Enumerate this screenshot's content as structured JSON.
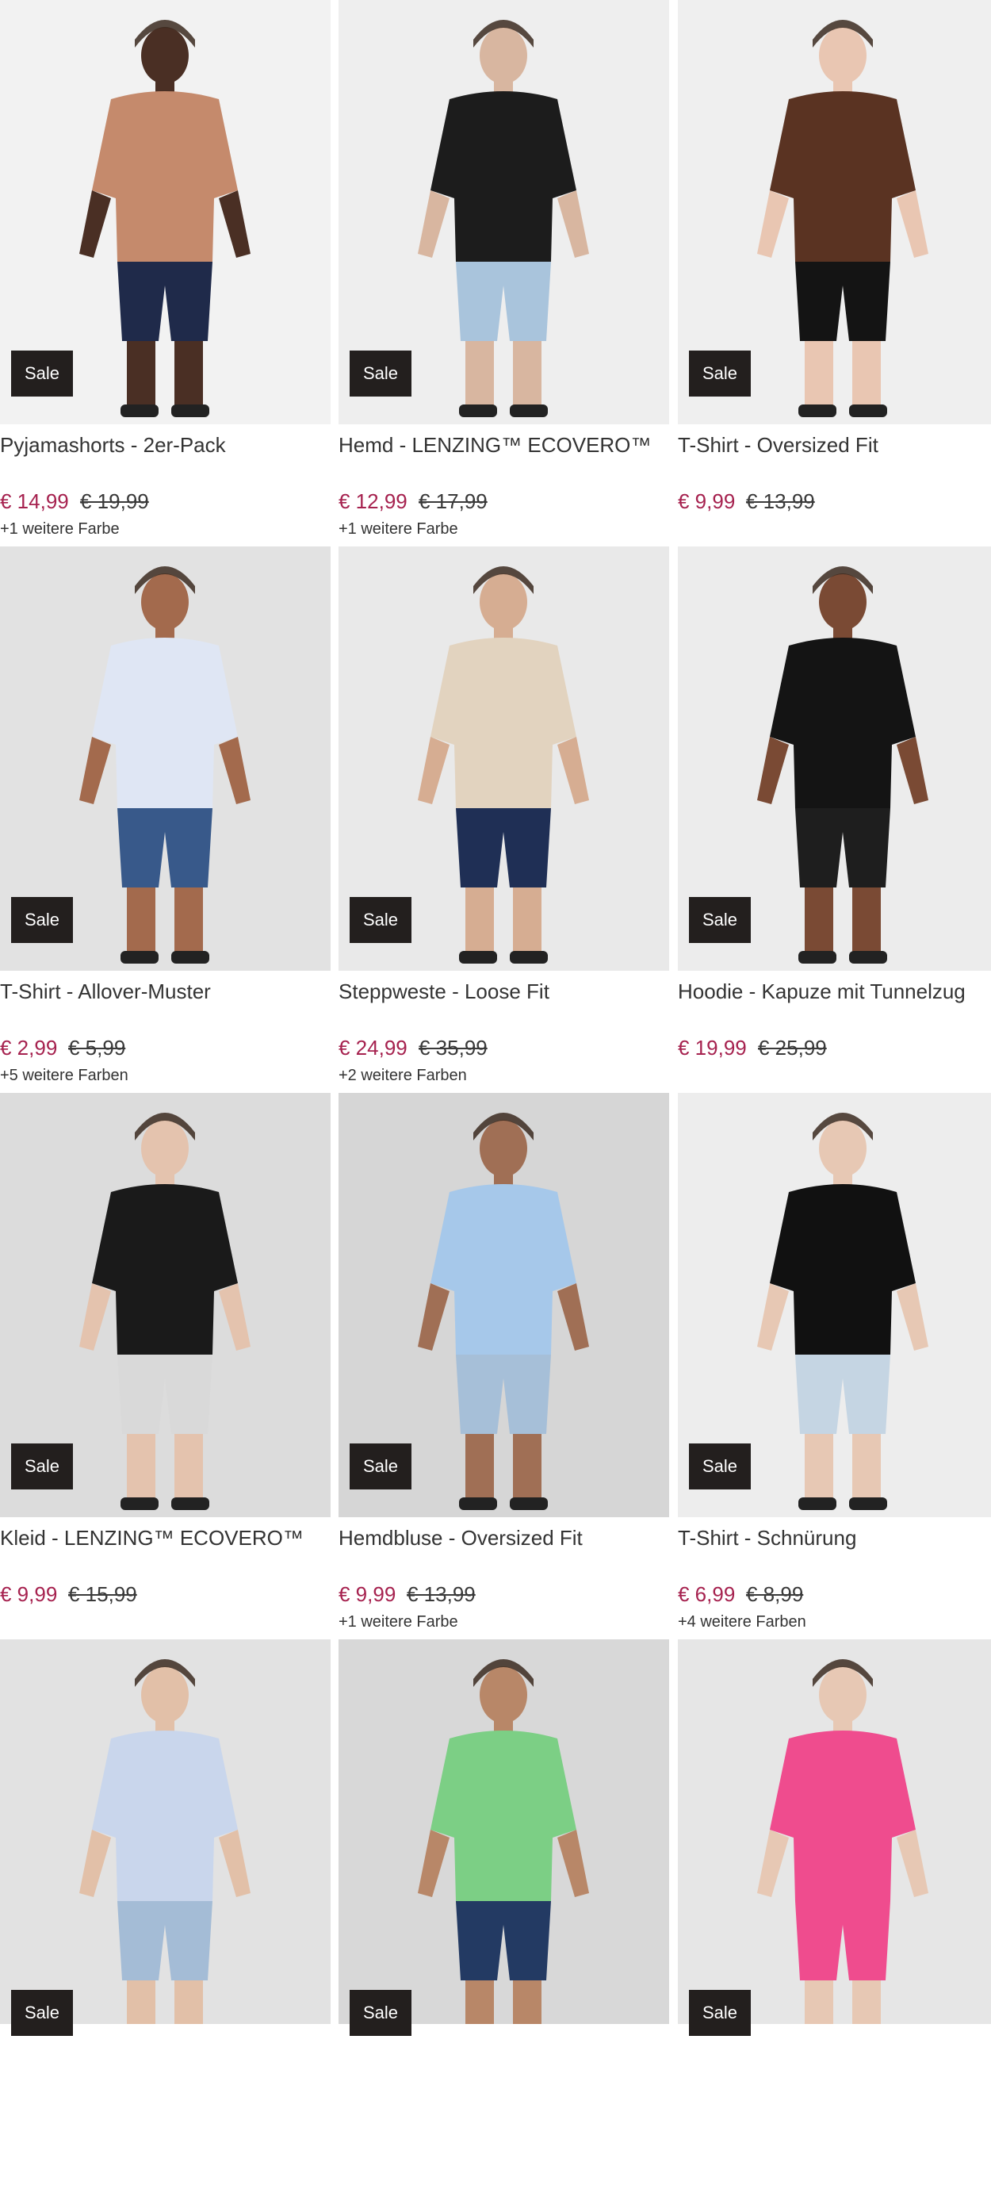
{
  "products": [
    {
      "title": "Pyjamashorts - 2er-Pack",
      "price": "€ 14,99",
      "old_price": "€ 19,99",
      "colors": "+1 weitere Farbe",
      "badge": "Sale",
      "bg": "#f2f2f2",
      "top": "#c58a6c",
      "bottom": "#1f2a4a",
      "skin": "#4a2f24"
    },
    {
      "title": "Hemd - LENZING™ ECOVERO™",
      "price": "€ 12,99",
      "old_price": "€ 17,99",
      "colors": "+1 weitere Farbe",
      "badge": "Sale",
      "bg": "#eeeeee",
      "top": "#1c1c1c",
      "bottom": "#a9c4dc",
      "skin": "#d8b6a0"
    },
    {
      "title": "T-Shirt - Oversized Fit",
      "price": "€ 9,99",
      "old_price": "€ 13,99",
      "colors": "",
      "badge": "Sale",
      "bg": "#efefef",
      "top": "#5a3322",
      "bottom": "#141414",
      "skin": "#e9c6b2"
    },
    {
      "title": "T-Shirt - Allover-Muster",
      "price": "€ 2,99",
      "old_price": "€ 5,99",
      "colors": "+5 weitere Farben",
      "badge": "Sale",
      "bg": "#e2e2e2",
      "top": "#dfe6f4",
      "bottom": "#38598a",
      "skin": "#a36a4d"
    },
    {
      "title": "Steppweste - Loose Fit",
      "price": "€ 24,99",
      "old_price": "€ 35,99",
      "colors": "+2 weitere Farben",
      "badge": "Sale",
      "bg": "#e9e9e9",
      "top": "#e2d3bf",
      "bottom": "#1f2f55",
      "skin": "#d6ad92"
    },
    {
      "title": "Hoodie - Kapuze mit Tunnelzug",
      "price": "€ 19,99",
      "old_price": "€ 25,99",
      "colors": "",
      "badge": "Sale",
      "bg": "#ececec",
      "top": "#141414",
      "bottom": "#1e1e1e",
      "skin": "#7a4a34"
    },
    {
      "title": "Kleid - LENZING™ ECOVERO™",
      "price": "€ 9,99",
      "old_price": "€ 15,99",
      "colors": "",
      "badge": "Sale",
      "bg": "#dcdcdc",
      "top": "#1a1a1a",
      "bottom": "#d9d9d9",
      "skin": "#e4c3ae"
    },
    {
      "title": "Hemdbluse - Oversized Fit",
      "price": "€ 9,99",
      "old_price": "€ 13,99",
      "colors": "+1 weitere Farbe",
      "badge": "Sale",
      "bg": "#d6d6d6",
      "top": "#a6c8ea",
      "bottom": "#a6bfd8",
      "skin": "#a06f55"
    },
    {
      "title": "T-Shirt - Schnürung",
      "price": "€ 6,99",
      "old_price": "€ 8,99",
      "colors": "+4 weitere Farben",
      "badge": "Sale",
      "bg": "#ededed",
      "top": "#111111",
      "bottom": "#c5d5e3",
      "skin": "#e7c8b4"
    },
    {
      "title": "",
      "price": "",
      "old_price": "",
      "colors": "",
      "badge": "Sale",
      "bg": "#e2e2e2",
      "top": "#c9d6ec",
      "bottom": "#a4bcd6",
      "skin": "#e2c0a8"
    },
    {
      "title": "",
      "price": "",
      "old_price": "",
      "colors": "",
      "badge": "Sale",
      "bg": "#d8d8d8",
      "top": "#7ccf85",
      "bottom": "#233a63",
      "skin": "#b88768"
    },
    {
      "title": "",
      "price": "",
      "old_price": "",
      "colors": "",
      "badge": "Sale",
      "bg": "#e6e6e6",
      "top": "#ef4c8e",
      "bottom": "#ef4c8e",
      "skin": "#e7c8b4"
    }
  ]
}
